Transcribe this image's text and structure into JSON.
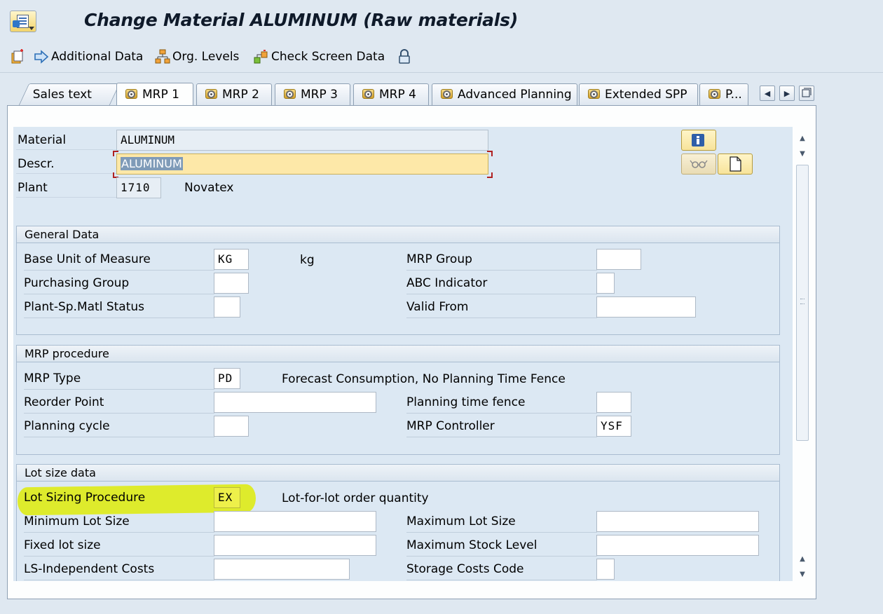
{
  "window": {
    "title": "Change Material ALUMINUM (Raw materials)"
  },
  "toolbar": {
    "items": [
      {
        "label": "",
        "icon": "new-entries-icon"
      },
      {
        "label": "Additional Data",
        "icon": "arrow-right-icon"
      },
      {
        "label": "Org. Levels",
        "icon": "org-structure-icon"
      },
      {
        "label": "Check Screen Data",
        "icon": "check-screen-icon"
      },
      {
        "label": "",
        "icon": "lock-icon"
      }
    ]
  },
  "tabs": [
    {
      "label": "Sales text",
      "active": false
    },
    {
      "label": "MRP 1",
      "active": true
    },
    {
      "label": "MRP 2",
      "active": false
    },
    {
      "label": "MRP 3",
      "active": false
    },
    {
      "label": "MRP 4",
      "active": false
    },
    {
      "label": "Advanced Planning",
      "active": false
    },
    {
      "label": "Extended SPP",
      "active": false
    },
    {
      "label": "P...",
      "active": false
    }
  ],
  "header": {
    "material_label": "Material",
    "material_value": "ALUMINUM",
    "descr_label": "Descr.",
    "descr_value": "ALUMINUM",
    "plant_label": "Plant",
    "plant_value": "1710",
    "plant_name": "Novatex"
  },
  "general": {
    "title": "General Data",
    "base_uom_label": "Base Unit of Measure",
    "base_uom_value": "KG",
    "base_uom_text": "kg",
    "purch_group_label": "Purchasing Group",
    "purch_group_value": "",
    "plant_status_label": "Plant-Sp.Matl Status",
    "plant_status_value": "",
    "mrp_group_label": "MRP Group",
    "mrp_group_value": "",
    "abc_label": "ABC Indicator",
    "abc_value": "",
    "valid_from_label": "Valid From",
    "valid_from_value": ""
  },
  "mrp_procedure": {
    "title": "MRP procedure",
    "mrp_type_label": "MRP Type",
    "mrp_type_value": "PD",
    "mrp_type_text": "Forecast Consumption, No Planning Time Fence",
    "reorder_label": "Reorder Point",
    "reorder_value": "",
    "planning_cycle_label": "Planning cycle",
    "planning_cycle_value": "",
    "time_fence_label": "Planning time fence",
    "time_fence_value": "",
    "controller_label": "MRP Controller",
    "controller_value": "YSF"
  },
  "lot_size": {
    "title": "Lot size data",
    "procedure_label": "Lot Sizing Procedure",
    "procedure_value": "EX",
    "procedure_text": "Lot-for-lot order quantity",
    "min_label": "Minimum Lot Size",
    "min_value": "",
    "fixed_label": "Fixed lot size",
    "fixed_value": "",
    "ls_costs_label": "LS-Independent Costs",
    "ls_costs_value": "",
    "max_label": "Maximum Lot Size",
    "max_value": "",
    "max_stock_label": "Maximum Stock Level",
    "max_stock_value": "",
    "storage_label": "Storage Costs Code",
    "storage_value": ""
  },
  "colors": {
    "background": "#dfe8f1",
    "panel": "#dce8f3",
    "highlight": "#deec00",
    "focused_field": "#fde8a8"
  }
}
